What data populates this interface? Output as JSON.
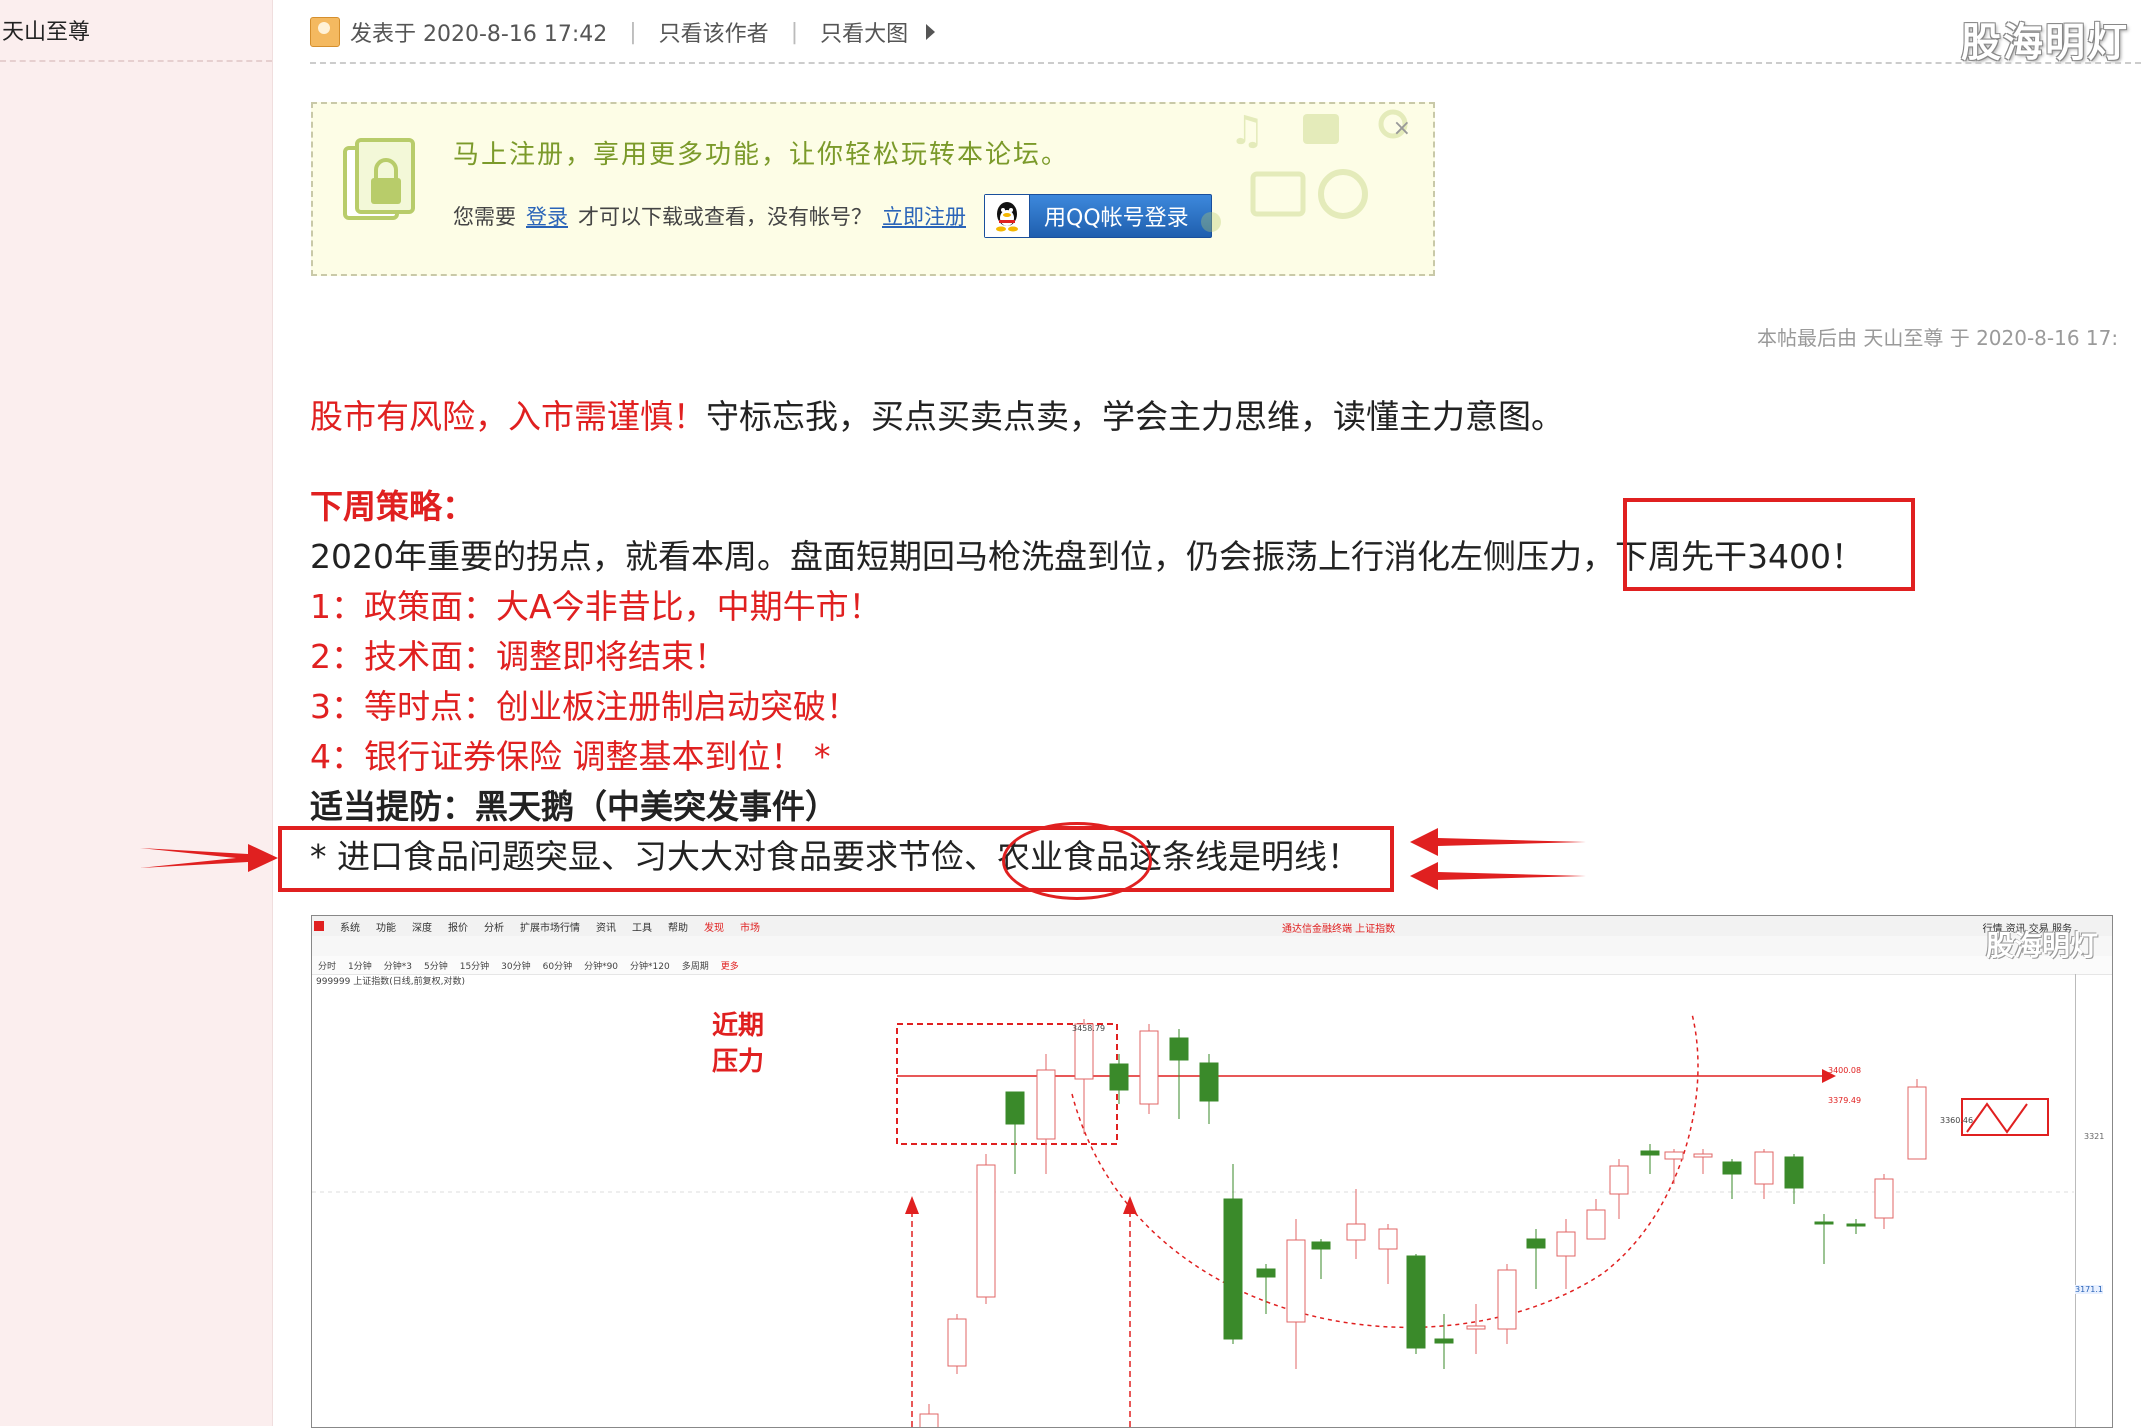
{
  "sidebar": {
    "author": "天山至尊"
  },
  "header": {
    "posted": "发表于 2020-8-16 17:42",
    "only_author": "只看该作者",
    "only_big_image": "只看大图",
    "watermark": "股海明灯"
  },
  "register": {
    "title": "马上注册，享用更多功能，让你轻松玩转本论坛。",
    "prefix": "您需要",
    "login_link": "登录",
    "middle": "才可以下载或查看，没有帐号？",
    "register_link": "立即注册",
    "qq_button": "用QQ帐号登录",
    "close": "×"
  },
  "edit_note": "本帖最后由 天山至尊 于 2020-8-16 17:",
  "post": {
    "intro_red": "股市有风险，入市需谨慎！",
    "intro_black": "守标忘我，买点买卖点卖，学会主力思维，读懂主力意图。",
    "strategy_title": "下周策略：",
    "line1_main": "2020年重要的拐点，就看本周。盘面短期回马枪洗盘到位，仍会振荡上行消化左侧压力，",
    "line1_highlight": "下周先干3400！",
    "point1": "1：政策面：大A今非昔比，中期牛市！",
    "point2": "2：技术面：调整即将结束！",
    "point3": "3：等时点：创业板注册制启动突破！",
    "point4": "4：银行证券保险 调整基本到位！ *",
    "caution": "适当提防：黑天鹅（中美突发事件）",
    "note_pre": "* 进口食品问题突显、习大大对食品要求节俭、",
    "note_circled": "农业食品",
    "note_post": "这条线是明线！"
  },
  "chart_screen": {
    "menu": [
      "系统",
      "功能",
      "深度",
      "报价",
      "分析",
      "扩展市场行情",
      "资讯",
      "工具",
      "帮助",
      "发现",
      "市场"
    ],
    "app_title": "通达信金融终端 上证指数",
    "periods": [
      "分时",
      "1分钟",
      "分钟*3",
      "5分钟",
      "15分钟",
      "30分钟",
      "60分钟",
      "分钟*90",
      "分钟*120",
      "多周期",
      "更多"
    ],
    "right_tabs": "行情  资讯  交易  服务",
    "index_label": "999999 上证指数(日线,前复权,对数)",
    "annotation_line1": "近期",
    "annotation_line2": "压力",
    "price_labels": [
      "3458.79",
      "3400.08",
      "3379.49",
      "3360.46",
      "3321",
      "3171.1"
    ],
    "watermark": "股海明灯"
  },
  "colors": {
    "accent_red": "#e02020",
    "register_green": "#7b9a2a",
    "link_blue": "#2a64b8",
    "candle_green": "#3a8a2a"
  }
}
